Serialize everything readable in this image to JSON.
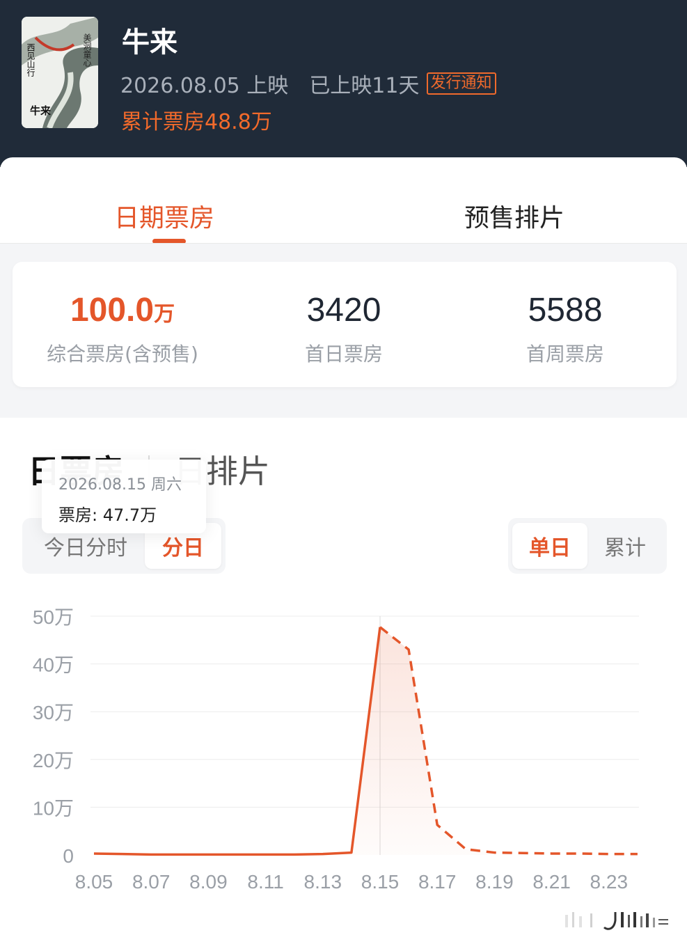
{
  "movie": {
    "title": "牛来",
    "release_date": "2026.08.05 上映",
    "days_released": "已上映11天",
    "notice_badge": "发行通知",
    "total_box_office": "累计票房48.8万",
    "poster": {
      "text_top_right": "美洞童心",
      "text_left": "西见山行",
      "text_bottom": "牛来"
    }
  },
  "tabs": [
    {
      "label": "日期票房",
      "active": true
    },
    {
      "label": "预售排片",
      "active": false
    }
  ],
  "stats": [
    {
      "value": "100.0",
      "unit": "万",
      "label": "综合票房(含预售)"
    },
    {
      "value": "3420",
      "unit": "",
      "label": "首日票房"
    },
    {
      "value": "5588",
      "unit": "",
      "label": "首周票房"
    }
  ],
  "section_tabs": [
    {
      "label": "日票房",
      "active": true
    },
    {
      "label": "日排片",
      "active": false
    }
  ],
  "mode_toggle": [
    {
      "label": "今日分时",
      "active": false
    },
    {
      "label": "分日",
      "active": true
    }
  ],
  "range_toggle": [
    {
      "label": "单日",
      "active": true
    },
    {
      "label": "累计",
      "active": false
    }
  ],
  "tooltip": {
    "date": "2026.08.15 周六",
    "value": "票房: 47.7万"
  },
  "colors": {
    "header_bg": "#202b39",
    "accent": "#e4562a",
    "line": "#e4562a"
  },
  "chart_data": {
    "type": "line",
    "x_tick_labels": [
      "8.05",
      "8.07",
      "8.09",
      "8.11",
      "8.13",
      "8.15",
      "8.17",
      "8.19",
      "8.21",
      "8.23"
    ],
    "y_tick_labels": [
      "0",
      "10万",
      "20万",
      "30万",
      "40万",
      "50万"
    ],
    "ylim": [
      0,
      50
    ],
    "grid": true,
    "highlight": "8.15",
    "series": [
      {
        "style": "solid",
        "points": [
          [
            "8.05",
            0.3
          ],
          [
            "8.06",
            0.2
          ],
          [
            "8.07",
            0.1
          ],
          [
            "8.08",
            0.1
          ],
          [
            "8.09",
            0.1
          ],
          [
            "8.10",
            0.1
          ],
          [
            "8.11",
            0.1
          ],
          [
            "8.12",
            0.1
          ],
          [
            "8.13",
            0.2
          ],
          [
            "8.14",
            0.5
          ],
          [
            "8.15",
            47.7
          ]
        ]
      },
      {
        "style": "dashed",
        "points": [
          [
            "8.15",
            47.7
          ],
          [
            "8.16",
            43.0
          ],
          [
            "8.17",
            6.3
          ],
          [
            "8.18",
            1.2
          ],
          [
            "8.19",
            0.5
          ],
          [
            "8.20",
            0.4
          ],
          [
            "8.21",
            0.3
          ],
          [
            "8.22",
            0.3
          ],
          [
            "8.23",
            0.2
          ],
          [
            "8.24",
            0.2
          ]
        ]
      }
    ]
  }
}
